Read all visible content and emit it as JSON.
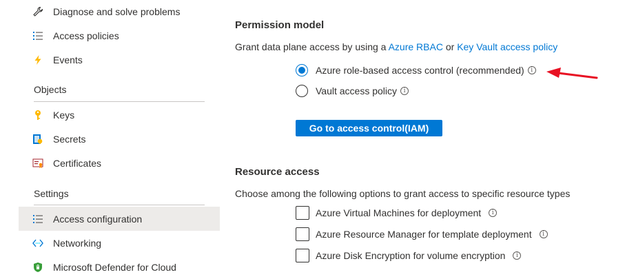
{
  "sidebar": {
    "items_top": [
      {
        "label": "Diagnose and solve problems",
        "icon": "wrench-icon"
      },
      {
        "label": "Access policies",
        "icon": "list-icon"
      },
      {
        "label": "Events",
        "icon": "lightning-icon"
      }
    ],
    "objects_header": "Objects",
    "objects": [
      {
        "label": "Keys",
        "icon": "key-icon"
      },
      {
        "label": "Secrets",
        "icon": "secret-icon"
      },
      {
        "label": "Certificates",
        "icon": "certificate-icon"
      }
    ],
    "settings_header": "Settings",
    "settings": [
      {
        "label": "Access configuration",
        "icon": "list-icon",
        "active": true
      },
      {
        "label": "Networking",
        "icon": "network-icon"
      },
      {
        "label": "Microsoft Defender for Cloud",
        "icon": "shield-icon"
      }
    ]
  },
  "permission_model": {
    "heading": "Permission model",
    "description_prefix": "Grant data plane access by using a",
    "link_rbac": "Azure RBAC",
    "connector": "or",
    "link_vault": "Key Vault access policy",
    "options": [
      {
        "label": "Azure role-based access control (recommended)",
        "checked": true
      },
      {
        "label": "Vault access policy",
        "checked": false
      }
    ],
    "button_label": "Go to access control(IAM)"
  },
  "resource_access": {
    "heading": "Resource access",
    "description": "Choose among the following options to grant access to specific resource types",
    "options": [
      {
        "label": "Azure Virtual Machines for deployment",
        "checked": false
      },
      {
        "label": "Azure Resource Manager for template deployment",
        "checked": false
      },
      {
        "label": "Azure Disk Encryption for volume encryption",
        "checked": false
      }
    ]
  },
  "info_glyph": "i",
  "colors": {
    "accent": "#0078d4",
    "active_bg": "#edebe9",
    "annotation_arrow": "#e81123"
  }
}
